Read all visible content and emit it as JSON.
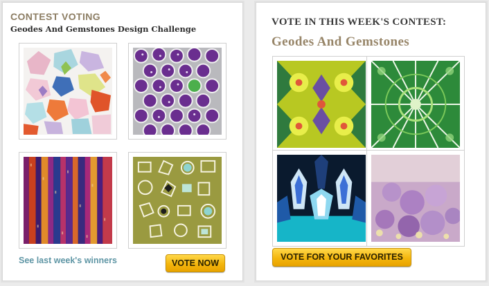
{
  "left": {
    "heading": "CONTEST VOTING",
    "subheading": "Geodes And Gemstones Design Challenge",
    "thumbnails": [
      {
        "name": "pastel-gem-pattern"
      },
      {
        "name": "purple-geode-dots-pattern"
      },
      {
        "name": "striped-amethyst-pattern"
      },
      {
        "name": "olive-gem-icons-pattern"
      }
    ],
    "link_text": "See last week's winners",
    "button_label": "VOTE NOW"
  },
  "right": {
    "heading": "VOTE IN THIS WEEK'S CONTEST:",
    "subheading": "Geodes And Gemstones",
    "thumbnails": [
      {
        "name": "green-kaleidoscope-pattern"
      },
      {
        "name": "green-star-mosaic-pattern"
      },
      {
        "name": "blue-crystal-mirror-pattern"
      },
      {
        "name": "purple-bokeh-pattern"
      }
    ],
    "button_label": "VOTE FOR YOUR FAVORITES"
  },
  "colors": {
    "accent_brown": "#8c7d63",
    "link_blue": "#5f96a5",
    "button_yellow": "#f4b60d"
  }
}
